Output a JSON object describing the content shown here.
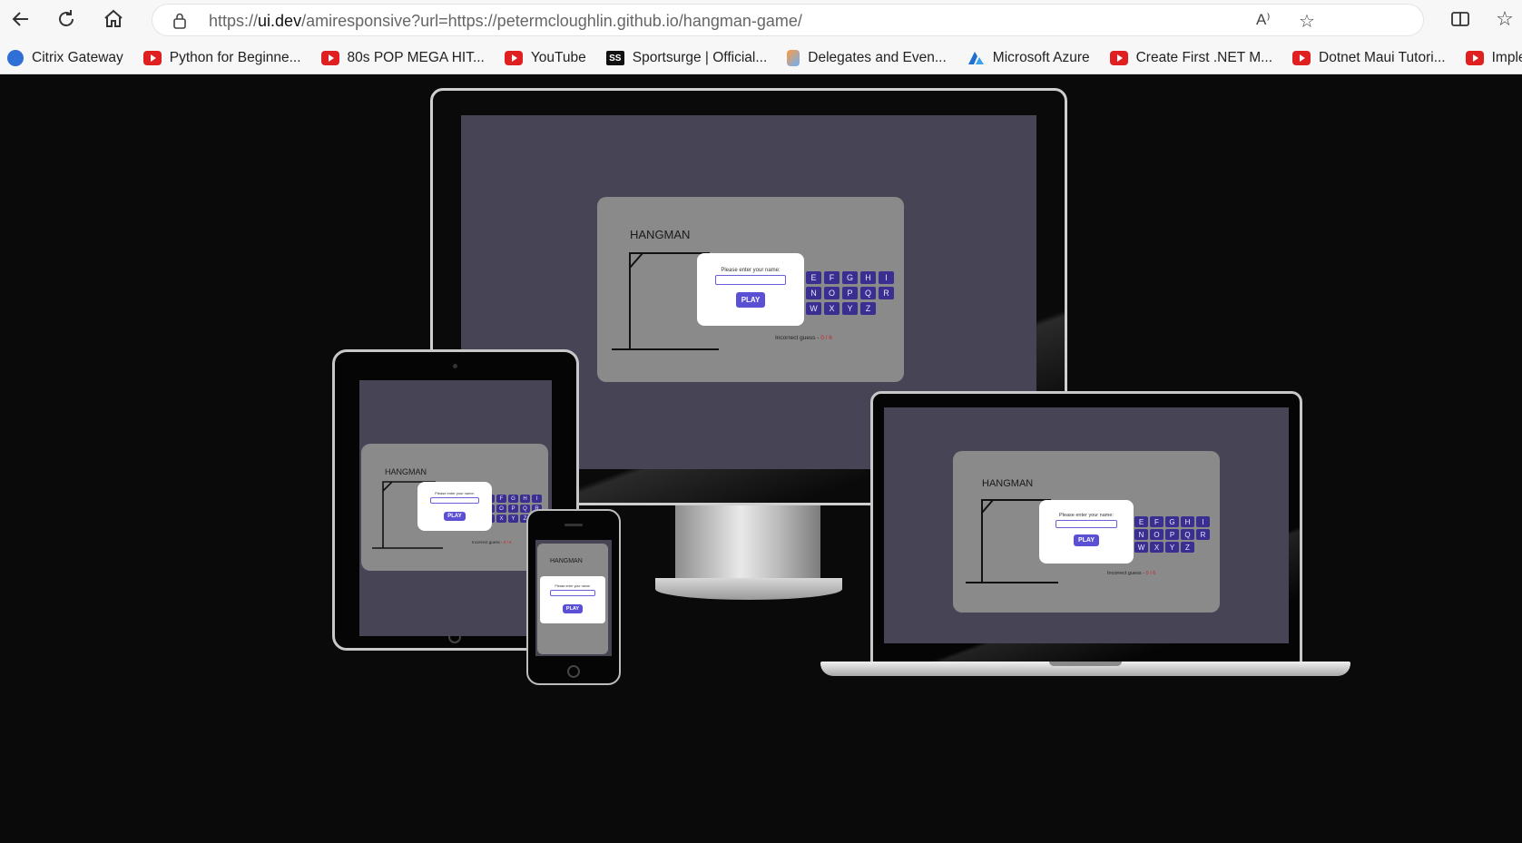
{
  "browser": {
    "url_prefix": "https://",
    "url_host": "ui.dev",
    "url_rest": "/amiresponsive?url=https://petermcloughlin.github.io/hangman-game/"
  },
  "bookmarks": [
    {
      "label": "Citrix Gateway",
      "icon": "citrix-icon"
    },
    {
      "label": "Python for Beginne...",
      "icon": "youtube-icon"
    },
    {
      "label": "80s POP MEGA HIT...",
      "icon": "youtube-icon"
    },
    {
      "label": "YouTube",
      "icon": "youtube-icon"
    },
    {
      "label": "Sportsurge | Official...",
      "icon": "sportsurge-icon"
    },
    {
      "label": "Delegates and Even...",
      "icon": "delegates-icon"
    },
    {
      "label": "Microsoft Azure",
      "icon": "azure-icon"
    },
    {
      "label": "Create First .NET M...",
      "icon": "youtube-icon"
    },
    {
      "label": "Dotnet Maui Tutori...",
      "icon": "youtube-icon"
    },
    {
      "label": "Implement QR",
      "icon": "youtube-icon"
    }
  ],
  "game": {
    "title": "HANGMAN",
    "prompt": "Please enter your name:",
    "play_label": "PLAY",
    "incorrect_label": "Incorrect guess - ",
    "incorrect_count": "0 / 6",
    "key_rows": [
      [
        "E",
        "F",
        "G",
        "H",
        "I"
      ],
      [
        "N",
        "O",
        "P",
        "Q",
        "R"
      ],
      [
        "W",
        "X",
        "Y",
        "Z"
      ]
    ]
  },
  "colors": {
    "stage_bg": "#0a0a0a",
    "screen_bg": "#474455",
    "card_bg": "#8a8a8a",
    "key_bg": "#3a2f91",
    "play_bg": "#5b4fd3"
  }
}
